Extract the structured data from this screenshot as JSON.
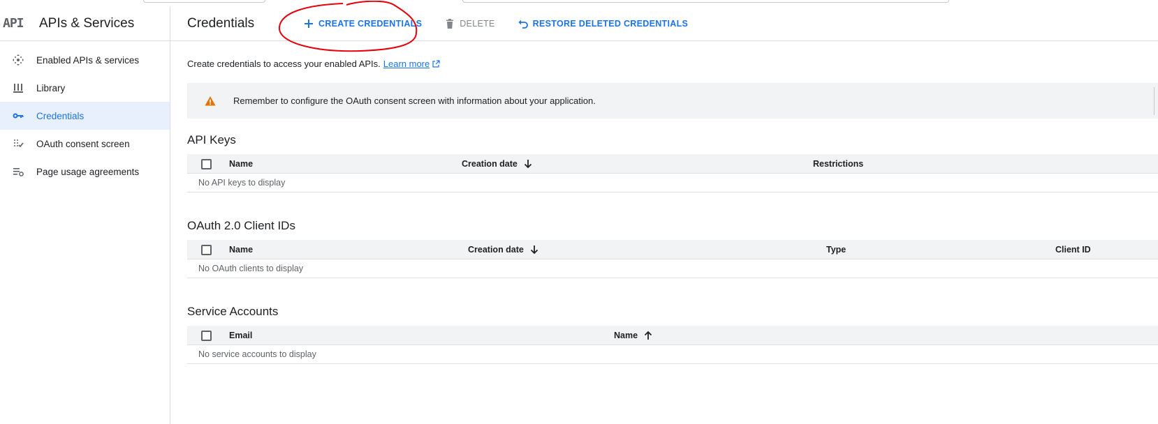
{
  "sidebar": {
    "logo_text": "API",
    "title": "APIs & Services",
    "items": [
      {
        "label": "Enabled APIs & services",
        "icon": "enabled-apis-icon"
      },
      {
        "label": "Library",
        "icon": "library-icon"
      },
      {
        "label": "Credentials",
        "icon": "key-icon",
        "active": true
      },
      {
        "label": "OAuth consent screen",
        "icon": "oauth-consent-icon"
      },
      {
        "label": "Page usage agreements",
        "icon": "page-usage-icon"
      }
    ]
  },
  "toolbar": {
    "title": "Credentials",
    "create_label": "CREATE CREDENTIALS",
    "delete_label": "DELETE",
    "restore_label": "RESTORE DELETED CREDENTIALS"
  },
  "intro": {
    "text": "Create credentials to access your enabled APIs.",
    "link": "Learn more"
  },
  "banner": {
    "text": "Remember to configure the OAuth consent screen with information about your application."
  },
  "api_keys": {
    "title": "API Keys",
    "columns": [
      "Name",
      "Creation date",
      "Restrictions"
    ],
    "empty": "No API keys to display"
  },
  "oauth": {
    "title": "OAuth 2.0 Client IDs",
    "columns": [
      "Name",
      "Creation date",
      "Type",
      "Client ID"
    ],
    "empty": "No OAuth clients to display"
  },
  "service_accounts": {
    "title": "Service Accounts",
    "columns": [
      "Email",
      "Name"
    ],
    "empty": "No service accounts to display"
  },
  "colors": {
    "accent": "#1a73e8",
    "active_bg": "#e8f0fe",
    "warning": "#e37400",
    "annotation": "#e8000b"
  }
}
